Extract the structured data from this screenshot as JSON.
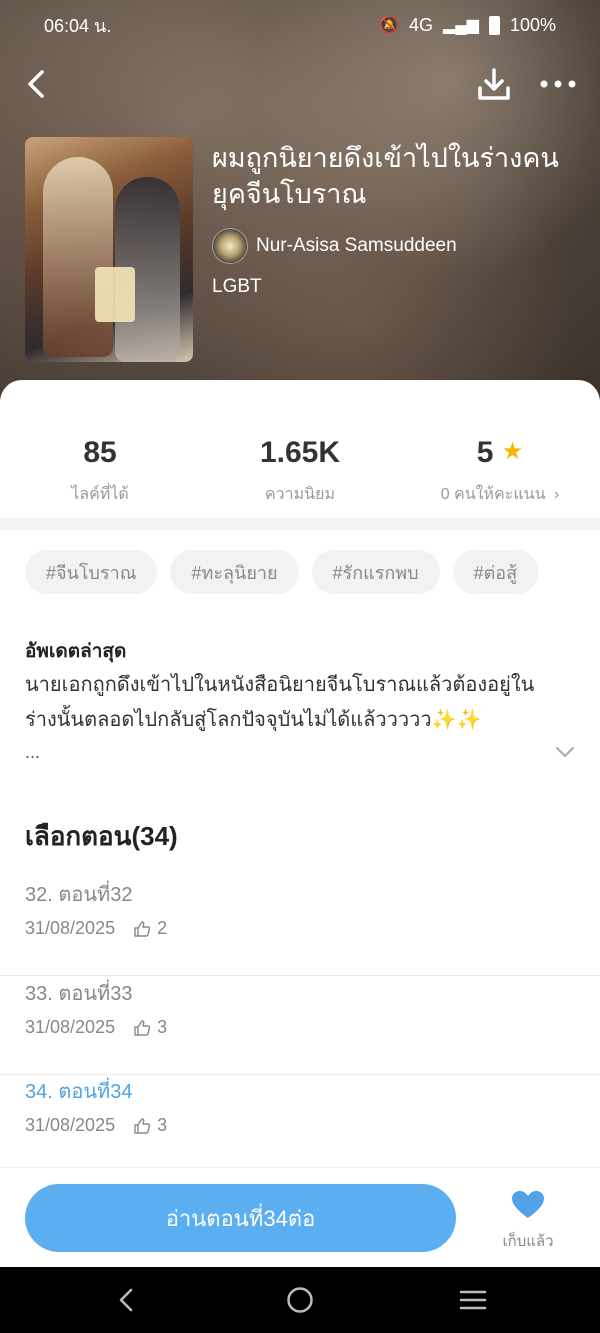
{
  "status_bar": {
    "time": "06:04 น.",
    "network": "4G",
    "battery": "100%"
  },
  "book": {
    "title": "ผมถูกนิยายดึงเข้าไปในร่างคนยุคจีนโบราณ",
    "author": "Nur-Asisa Samsuddeen",
    "genre": "LGBT"
  },
  "stats": [
    {
      "value": "85",
      "label": "ไลค์ที่ได้"
    },
    {
      "value": "1.65K",
      "label": "ความนิยม"
    },
    {
      "value": "5",
      "label": "0 คนให้คะแนน"
    }
  ],
  "tags": [
    "#จีนโบราณ",
    "#ทะลุนิยาย",
    "#รักแรกพบ",
    "#ต่อสู้"
  ],
  "update": {
    "heading": "อัพเดตล่าสุด",
    "text": "นายเอกถูกดึงเข้าไปในหนังสือนิยายจีนโบราณแล้วต้องอยู่ในร่างนั้นตลอดไปกลับสู่โลกปัจจุบันไม่ได้แล้ววววว✨✨",
    "more": "..."
  },
  "chapters": {
    "heading": "เลือกตอน(34)",
    "items": [
      {
        "title": "32. ตอนที่32",
        "date": "31/08/2025",
        "likes": "2",
        "active": false
      },
      {
        "title": "33. ตอนที่33",
        "date": "31/08/2025",
        "likes": "3",
        "active": false
      },
      {
        "title": "34. ตอนที่34",
        "date": "31/08/2025",
        "likes": "3",
        "active": true
      }
    ]
  },
  "actions": {
    "read_label": "อ่านตอนที่34ต่อ",
    "fav_label": "เก็บแล้ว"
  },
  "colors": {
    "accent": "#5baef0",
    "active_chapter": "#4fa3e6",
    "star": "#f5b800"
  }
}
